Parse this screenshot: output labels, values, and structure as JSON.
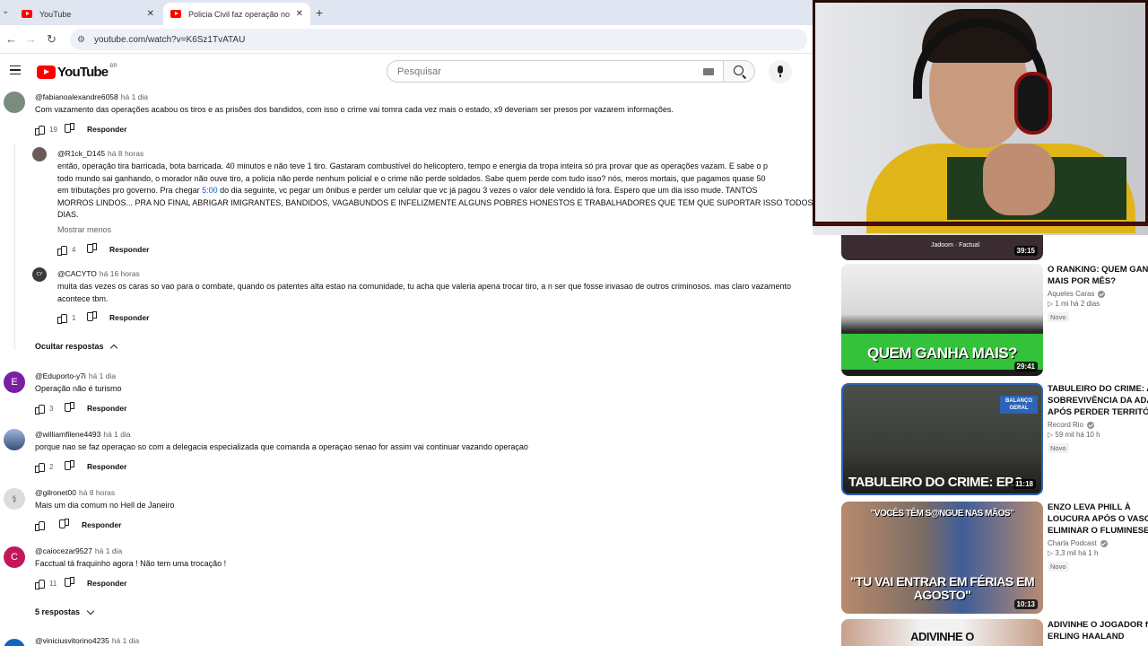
{
  "browser": {
    "tabs": [
      {
        "title": "YouTube",
        "active": false
      },
      {
        "title": "Policia Civil faz operação no Fal",
        "active": true
      }
    ],
    "url": "youtube.com/watch?v=K6Sz1TvATAU"
  },
  "youtube": {
    "logo_text": "YouTube",
    "country_code": "BR",
    "search_placeholder": "Pesquisar"
  },
  "comments": [
    {
      "author": "@fabianoalexandre6058",
      "time": "há 1 dia",
      "text": "Com vazamento das operações acabou os tiros e as prisões dos bandidos, com isso o crime vai tomra cada vez mais o estado, x9 deveriam ser presos por vazarem informações.",
      "likes": "19",
      "reply_label": "Responder"
    },
    {
      "author": "@R1ck_D145",
      "time": "há 8 horas",
      "text_lines": [
        "então, operação tira barricada, bota barricada. 40 minutos e não teve 1 tiro. Gastaram combustível do helicoptero, tempo e energia da tropa inteira só pra provar que as operações vazam. E sabe o p",
        "todo mundo sai ganhando, o morador não ouve tiro, a policia não perde nenhum policial e o crime não perde soldados. Sabe quem perde com tudo isso? nós, meros mortais, que pagamos quase 50",
        "em tributações pro governo. Pra chegar ",
        " do dia seguinte, vc pegar um ônibus e perder um celular que vc já pagou 3 vezes o valor dele vendido lá fora. Espero que um dia isso mude. TANTOS",
        "MORROS LINDOS... PRA NO FINAL ABRIGAR IMIGRANTES, BANDIDOS, VAGABUNDOS E INFELIZMENTE ALGUNS POBRES HONESTOS E TRABALHADORES QUE TEM QUE SUPORTAR ISSO TODOS O",
        "DIAS."
      ],
      "timestamp_link": "5:00",
      "show_less": "Mostrar menos",
      "likes": "4",
      "reply_label": "Responder"
    },
    {
      "author": "@CACYTO",
      "time": "há 16 horas",
      "text": "muita das vezes os caras so vao para o combate, quando os patentes alta estao na comunidade, tu acha que valeria apena trocar tiro, a n ser que fosse invasao de outros criminosos. mas claro vazamento acontece tbm.",
      "likes": "1",
      "reply_label": "Responder"
    },
    {
      "author": "@Eduporto-y7i",
      "time": "há 1 dia",
      "text": "Operação não é turismo",
      "likes": "3",
      "reply_label": "Responder",
      "avatar_letter": "E"
    },
    {
      "author": "@williamfilene4493",
      "time": "há 1 dia",
      "text": "porque  nao se faz operaçao so com a delegacia especializada que comanda a operaçao senao for assim vai continuar vazando operaçao",
      "likes": "2",
      "reply_label": "Responder"
    },
    {
      "author": "@gilronet00",
      "time": "há 8 horas",
      "text": "Mais um dia comum no Hell de Janeiro",
      "likes": "",
      "reply_label": "Responder"
    },
    {
      "author": "@caiocezar9527",
      "time": "há 1 dia",
      "text": "Facctual tá fraquinho agora ! Não tem uma trocação !",
      "likes": "11",
      "reply_label": "Responder",
      "avatar_letter": "C"
    },
    {
      "author": "@viniciusvitorino4235",
      "time": "há 1 dia"
    }
  ],
  "hide_replies": "Ocultar respostas",
  "five_replies": "5 respostas",
  "recommendations": [
    {
      "duration": "39:15",
      "channel_watermark": "Jadoom · Factual"
    },
    {
      "title": "O RANKING: QUEM GANH\nMAIS POR MÊS?",
      "channel": "Aqueles Caras",
      "stats": "▷ 1 mi  há 2 dias",
      "badge": "Novo",
      "duration": "29:41",
      "caption": "QUEM GANHA MAIS?"
    },
    {
      "title": "TABULEIRO DO CRIME: A\nSOBREVIVÊNCIA DA ADA\nAPÓS PERDER TERRITÓR",
      "channel": "Record Rio",
      "stats": "▷ 59 mil  há 10 h",
      "badge": "Novo",
      "duration": "11:18",
      "caption": "TABULEIRO DO CRIME: EP.3",
      "corner_badge": "BALANÇO GERAL"
    },
    {
      "title": "ENZO LEVA PHILL À\nLOUCURA APÓS O VASCO\nELIMINAR O FLUMINESE",
      "channel": "Charla Podcast",
      "stats": "▷ 3,3 mil  há 1 h",
      "badge": "Novo",
      "duration": "10:13",
      "caption_top": "\"VOCÊS TÊM S@NGUE NAS MÃOS\"",
      "caption": "\"TU VAI ENTRAR EM FÉRIAS EM AGOSTO\""
    },
    {
      "title": "ADIVINHE O JOGADOR ft.\nERLING HAALAND",
      "caption": "ADIVINHE O"
    }
  ],
  "colors": {
    "accent_red": "#ff0000",
    "link_blue": "#065fd4",
    "muted": "#606060"
  }
}
